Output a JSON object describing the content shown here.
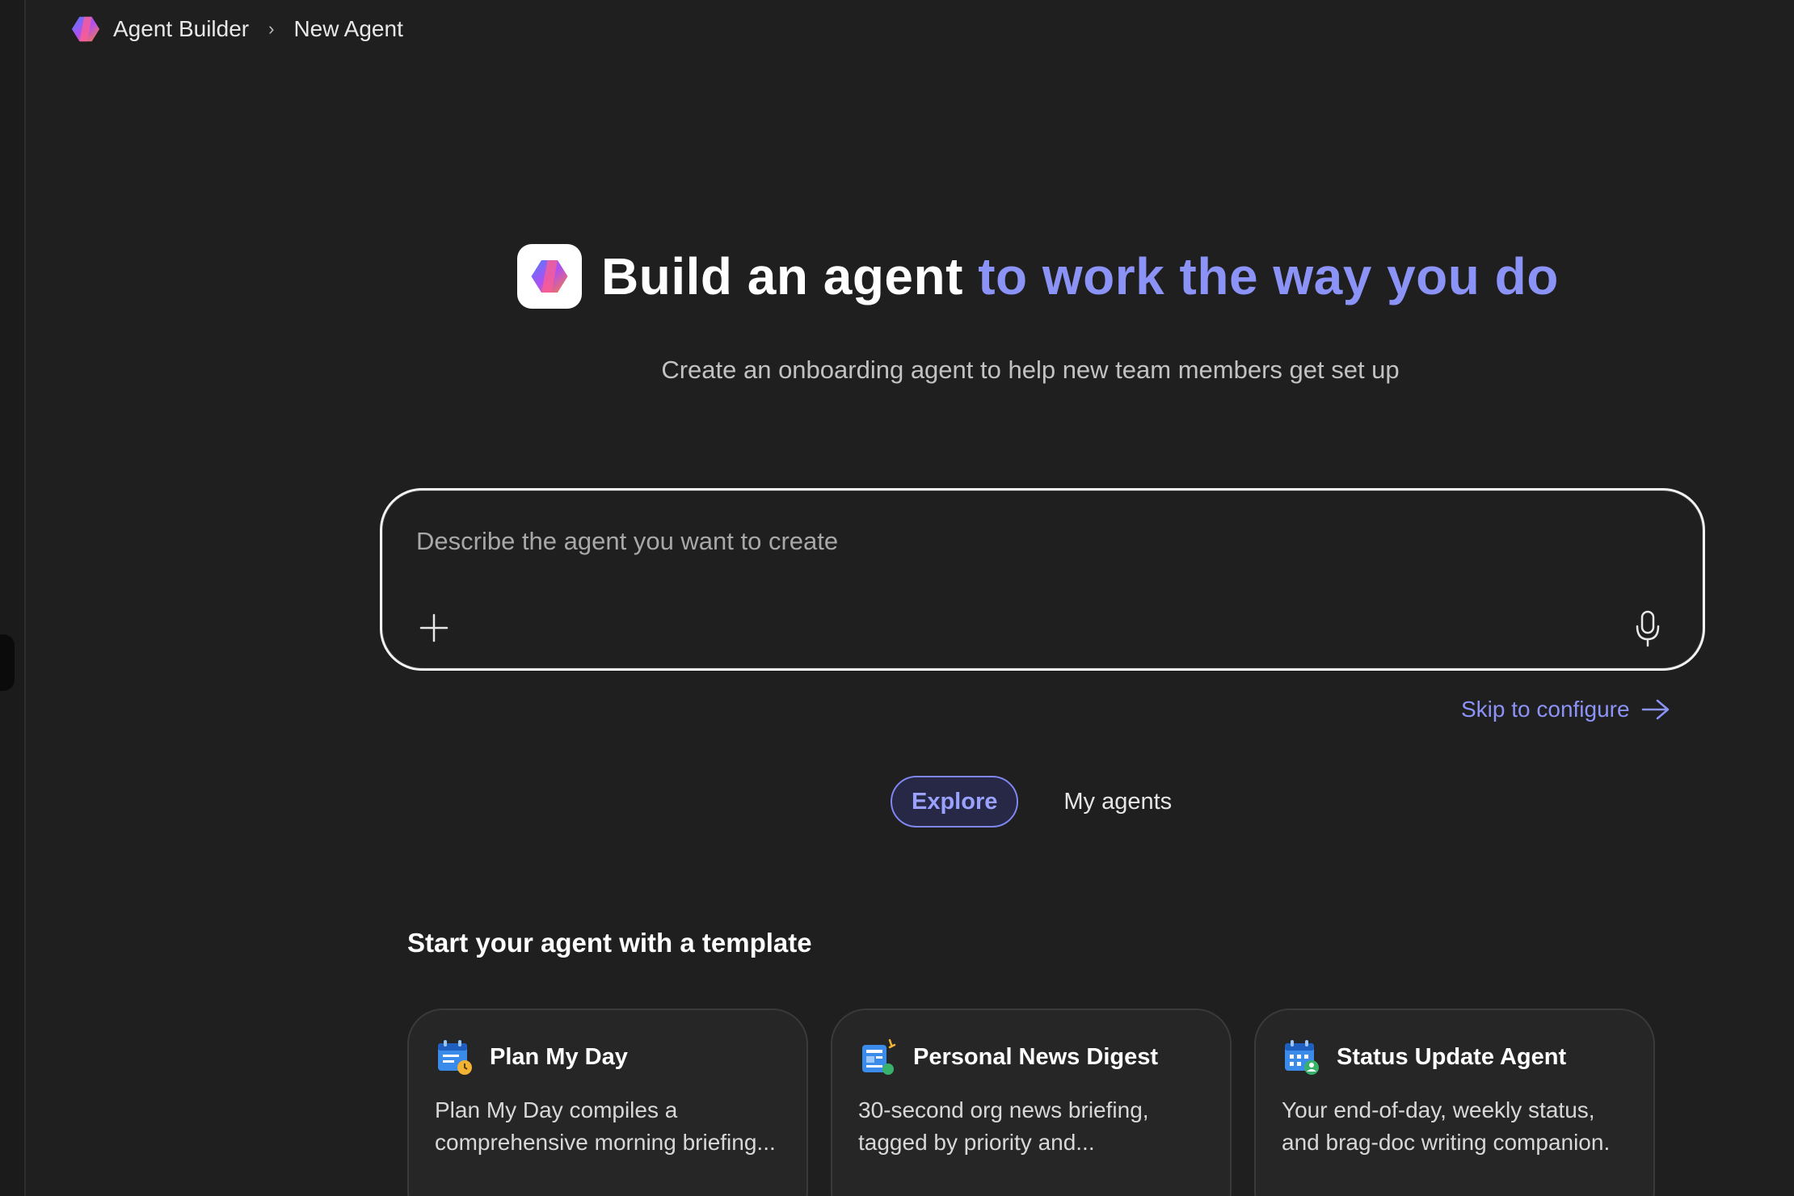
{
  "breadcrumb": {
    "app_name": "Agent Builder",
    "separator": "›",
    "current": "New Agent"
  },
  "hero": {
    "title_prefix": "Build an agent",
    "title_accent": "to work the way you do",
    "subtitle": "Create an onboarding agent to help new team members get set up"
  },
  "prompt": {
    "placeholder": "Describe the agent you want to create",
    "add_icon": "plus-icon",
    "mic_icon": "microphone-icon"
  },
  "skip": {
    "label": "Skip to configure",
    "icon": "arrow-right-icon"
  },
  "tabs": [
    {
      "label": "Explore",
      "active": true
    },
    {
      "label": "My agents",
      "active": false
    }
  ],
  "section_title": "Start your agent with a template",
  "templates": [
    {
      "title": "Plan My Day",
      "description": "Plan My Day compiles a comprehensive morning briefing...",
      "icon": "calendar-clock-icon"
    },
    {
      "title": "Personal News Digest",
      "description": "30-second org news briefing, tagged by priority and...",
      "icon": "newspaper-icon"
    },
    {
      "title": "Status Update Agent",
      "description": "Your end-of-day, weekly status, and brag-doc writing companion.",
      "icon": "calendar-person-icon"
    }
  ],
  "colors": {
    "background": "#1f1f1f",
    "accent": "#8c93f7",
    "card_background": "#262626",
    "card_border": "#3a3a3a"
  }
}
